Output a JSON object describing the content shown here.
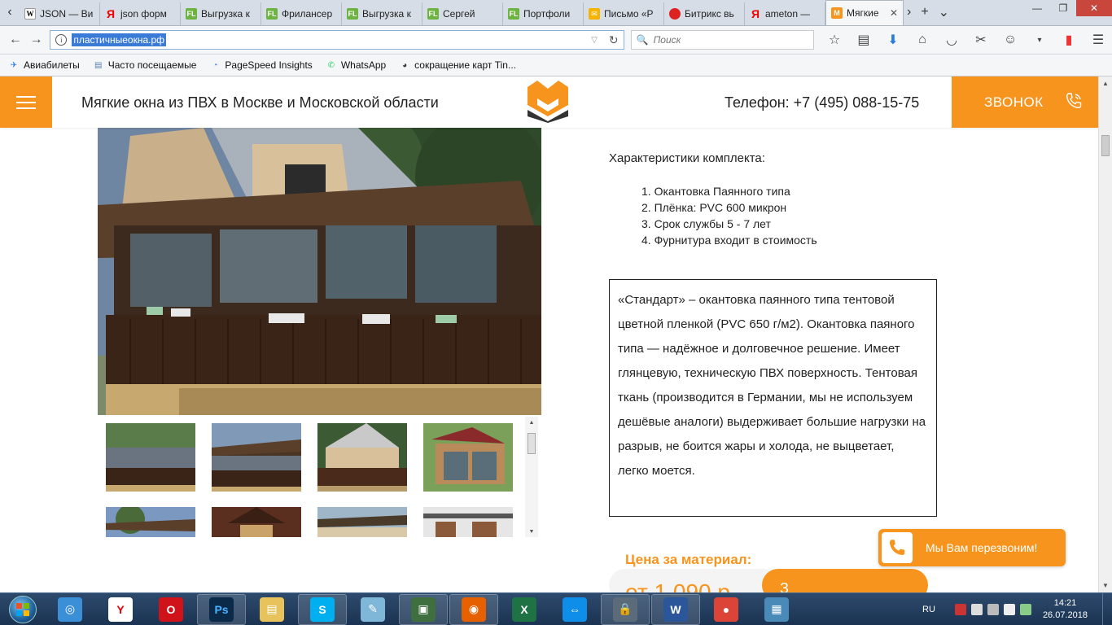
{
  "browser": {
    "tabs": [
      {
        "label": "JSON — Ви",
        "icon": "wikipedia-icon",
        "fav": "W",
        "cls": "fav-w"
      },
      {
        "label": "json форм",
        "icon": "yandex-icon",
        "fav": "Я",
        "cls": "fav-y"
      },
      {
        "label": "Выгрузка к",
        "icon": "fl-icon",
        "fav": "FL",
        "cls": "fav-fl"
      },
      {
        "label": "Фрилансер",
        "icon": "fl-icon",
        "fav": "FL",
        "cls": "fav-fl"
      },
      {
        "label": "Выгрузка к",
        "icon": "fl-icon",
        "fav": "FL",
        "cls": "fav-fl"
      },
      {
        "label": "Сергей",
        "icon": "fl-icon",
        "fav": "FL",
        "cls": "fav-fl"
      },
      {
        "label": "Портфоли",
        "icon": "fl-icon",
        "fav": "FL",
        "cls": "fav-fl"
      },
      {
        "label": "Письмо «Р",
        "icon": "mail-icon",
        "fav": "✉",
        "cls": "fav-mail"
      },
      {
        "label": "Битрикс вь",
        "icon": "bitrix-icon",
        "fav": "",
        "cls": "fav-bx"
      },
      {
        "label": "ameton —",
        "icon": "yandex-icon",
        "fav": "Я",
        "cls": "fav-y"
      }
    ],
    "active_tab": {
      "label": "Мягкие",
      "close": "✕"
    },
    "url": "пластичныеокна.рф",
    "search_placeholder": "Поиск",
    "bookmarks": [
      {
        "label": "Авиабилеты",
        "icon": "plane-icon"
      },
      {
        "label": "Часто посещаемые",
        "icon": "history-icon"
      },
      {
        "label": "PageSpeed Insights",
        "icon": "pagespeed-icon"
      },
      {
        "label": "WhatsApp",
        "icon": "whatsapp-icon"
      },
      {
        "label": "сокращение карт Tin...",
        "icon": "panda-icon"
      }
    ]
  },
  "site": {
    "title": "Мягкие окна из ПВХ в Москве и Московской области",
    "phone": "Телефон: +7 (495) 088-15-75",
    "call_button": "ЗВОНОК",
    "specs_title": "Характеристики комплекта:",
    "specs": [
      "Окантовка Паянного типа",
      "Плёнка: PVC 600 микрон",
      "Срок службы 5 - 7 лет",
      "Фурнитура входит в стоимость"
    ],
    "description": "«Стандарт» – окантовка паянного типа тентовой цветной пленкой (PVC 650 г/м2). Окантовка паяного типа — надёжное и долговечное решение. Имеет глянцевую, техническую ПВХ поверхность. Тентовая ткань (производится в Германии, мы не используем дешёвые аналоги) выдерживает большие нагрузки на разрыв, не боится жары и холода, не выцветает, легко моется.",
    "price_label": "Цена за материал:",
    "price_value": "от 1 090 р.",
    "order_button": "З",
    "callback": "Мы Вам перезвоним!"
  },
  "taskbar": {
    "apps": [
      {
        "name": "taskbar-safari-icon",
        "glyph": "◎",
        "bg": "#3a8fd6",
        "active": false
      },
      {
        "name": "taskbar-yandex-browser-icon",
        "glyph": "Y",
        "bg": "#ffffff",
        "fg": "#e00",
        "active": false
      },
      {
        "name": "taskbar-opera-icon",
        "glyph": "O",
        "bg": "#d0121b",
        "active": false
      },
      {
        "name": "taskbar-photoshop-icon",
        "glyph": "Ps",
        "bg": "#0b2a4a",
        "fg": "#4bb2ff",
        "active": true
      },
      {
        "name": "taskbar-explorer-icon",
        "glyph": "▤",
        "bg": "#e8c25a",
        "active": false
      },
      {
        "name": "taskbar-skype-icon",
        "glyph": "S",
        "bg": "#00aff0",
        "active": true
      },
      {
        "name": "taskbar-notepad-icon",
        "glyph": "✎",
        "bg": "#7fb7d9",
        "active": false
      },
      {
        "name": "taskbar-monitor-icon",
        "glyph": "▣",
        "bg": "#3f6e3f",
        "active": true
      },
      {
        "name": "taskbar-firefox-icon",
        "glyph": "◉",
        "bg": "#e66000",
        "active": true
      },
      {
        "name": "taskbar-excel-icon",
        "glyph": "X",
        "bg": "#1f7244",
        "active": false
      },
      {
        "name": "taskbar-teamviewer-icon",
        "glyph": "⇔",
        "bg": "#0e8ee9",
        "active": false
      },
      {
        "name": "taskbar-vpn-icon",
        "glyph": "🔒",
        "bg": "#5b6b7a",
        "active": true
      },
      {
        "name": "taskbar-word-icon",
        "glyph": "W",
        "bg": "#2b579a",
        "active": true
      },
      {
        "name": "taskbar-chrome-icon",
        "glyph": "●",
        "bg": "#db4437",
        "active": false
      },
      {
        "name": "taskbar-photo-viewer-icon",
        "glyph": "▦",
        "bg": "#4a8ab8",
        "active": false
      }
    ],
    "lang": "RU",
    "time": "14:21",
    "date": "26.07.2018"
  },
  "colors": {
    "accent": "#f7941d"
  }
}
